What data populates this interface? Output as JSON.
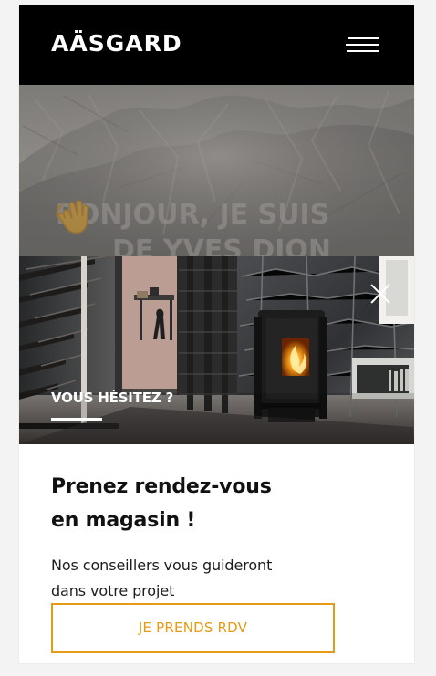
{
  "header": {
    "logo": "AÄSGARD",
    "menu_icon": "hamburger-menu-icon"
  },
  "hero": {
    "greeting": "BONJOUR",
    "emoji_icon": "waving-hand-icon",
    "title_rest": ", JE SUIS",
    "title_line2": "DE YVES DION"
  },
  "popup": {
    "close_icon": "close-icon",
    "eyebrow": "VOUS HÉSITEZ ?",
    "heading_line1": "Prenez rendez-vous",
    "heading_line2": "en magasin !",
    "body_line1": "Nos conseillers vous guideront",
    "body_line2": "dans votre projet",
    "button_label": "JE PRENDS RDV"
  },
  "colors": {
    "header_bg": "#000000",
    "accent": "#e59b18",
    "text_dark": "#111111",
    "hero_bg": "#8b8886"
  }
}
